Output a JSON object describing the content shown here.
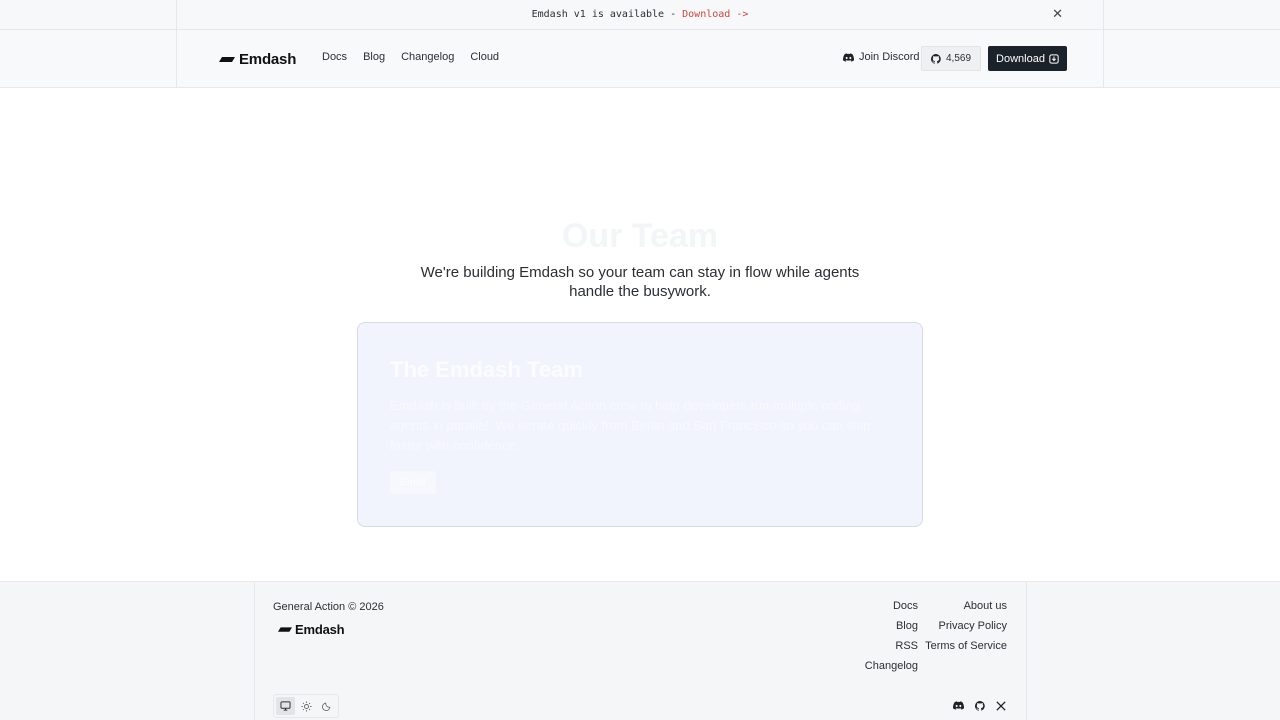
{
  "banner": {
    "text": "Emdash v1 is available - ",
    "link": "Download ->",
    "close_icon": "close-icon"
  },
  "header": {
    "logo_text": "Emdash",
    "nav": [
      "Docs",
      "Blog",
      "Changelog",
      "Cloud"
    ],
    "discord_label": "Join Discord",
    "github_stars": "4,569",
    "download_label": "Download"
  },
  "hero": {
    "title": "Our Team",
    "subtitle": "We're building Emdash so your team can stay in flow while agents handle the busywork."
  },
  "card": {
    "title": "The Emdash Team",
    "body": "Emdash is built by the General Action crew to help developers run multiple coding agents in parallel. We iterate quickly from Berlin and San Francisco so you can ship faster with confidence.",
    "button": "Email"
  },
  "footer": {
    "copyright": "General Action © 2026",
    "logo_text": "Emdash",
    "col1": [
      "Docs",
      "Blog",
      "RSS",
      "Changelog"
    ],
    "col2": [
      "About us",
      "Privacy Policy",
      "Terms of Service"
    ],
    "theme_options": [
      "monitor-icon",
      "sun-icon",
      "moon-icon"
    ],
    "socials": [
      "discord-icon",
      "github-icon",
      "x-icon"
    ]
  },
  "colors": {
    "accent_red": "#d0453f",
    "dark_button": "#1c2229",
    "card_bg": "#f1f4fd"
  }
}
